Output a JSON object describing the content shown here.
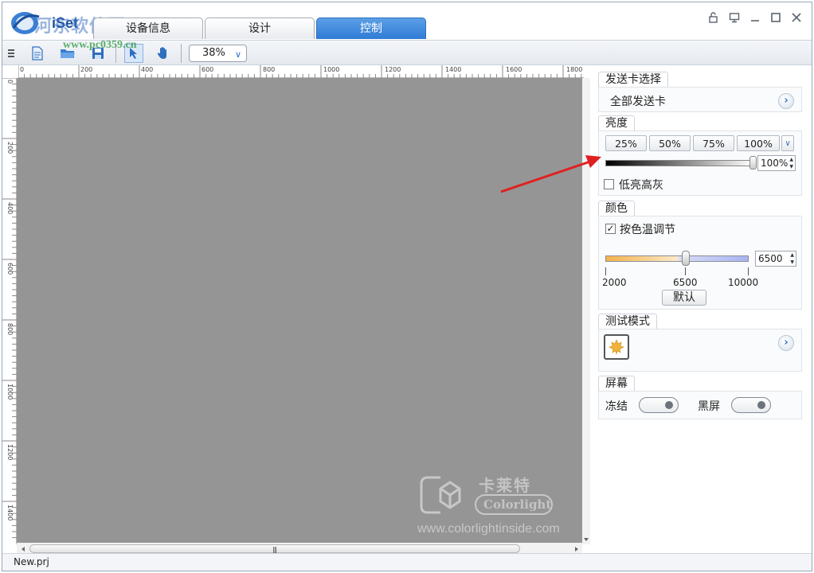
{
  "app": {
    "name": "iSet",
    "watermark_text": "河东软件园",
    "watermark_url": "www.pc0359.cn"
  },
  "tabs": [
    {
      "label": "设备信息",
      "active": false
    },
    {
      "label": "设计",
      "active": false
    },
    {
      "label": "控制",
      "active": true
    }
  ],
  "toolbar": {
    "zoom_value": "38%"
  },
  "rulers": {
    "horizontal": [
      "0",
      "200",
      "400",
      "600",
      "800",
      "1000",
      "1200",
      "1400",
      "1600",
      "1800"
    ],
    "vertical": [
      "0",
      "200",
      "400",
      "600",
      "800",
      "1000",
      "1200",
      "1400"
    ]
  },
  "canvas": {
    "logo_cn": "卡莱特",
    "logo_en": "Colorlight",
    "url": "www.colorlightinside.com"
  },
  "status": {
    "file": "New.prj"
  },
  "panel": {
    "sending_card": {
      "title": "发送卡选择",
      "value": "全部发送卡"
    },
    "brightness": {
      "title": "亮度",
      "presets": [
        "25%",
        "50%",
        "75%",
        "100%"
      ],
      "value": "100%",
      "level": 1.0,
      "low_bright_label": "低亮高灰",
      "low_bright_checked": false
    },
    "color": {
      "title": "颜色",
      "temp_label": "按色温调节",
      "temp_checked": true,
      "temp_value": "6500",
      "temp_min": 2000,
      "temp_max": 10000,
      "temp_current": 6500,
      "ticks": [
        "2000",
        "6500",
        "10000"
      ],
      "default_label": "默认"
    },
    "test_mode": {
      "title": "测试模式"
    },
    "screen": {
      "title": "屏幕",
      "freeze_label": "冻结",
      "black_label": "黑屏"
    }
  },
  "colors": {
    "accent_tab": "#2f7bd6",
    "canvas_gray": "#959595",
    "arrow_red": "#e02020"
  }
}
